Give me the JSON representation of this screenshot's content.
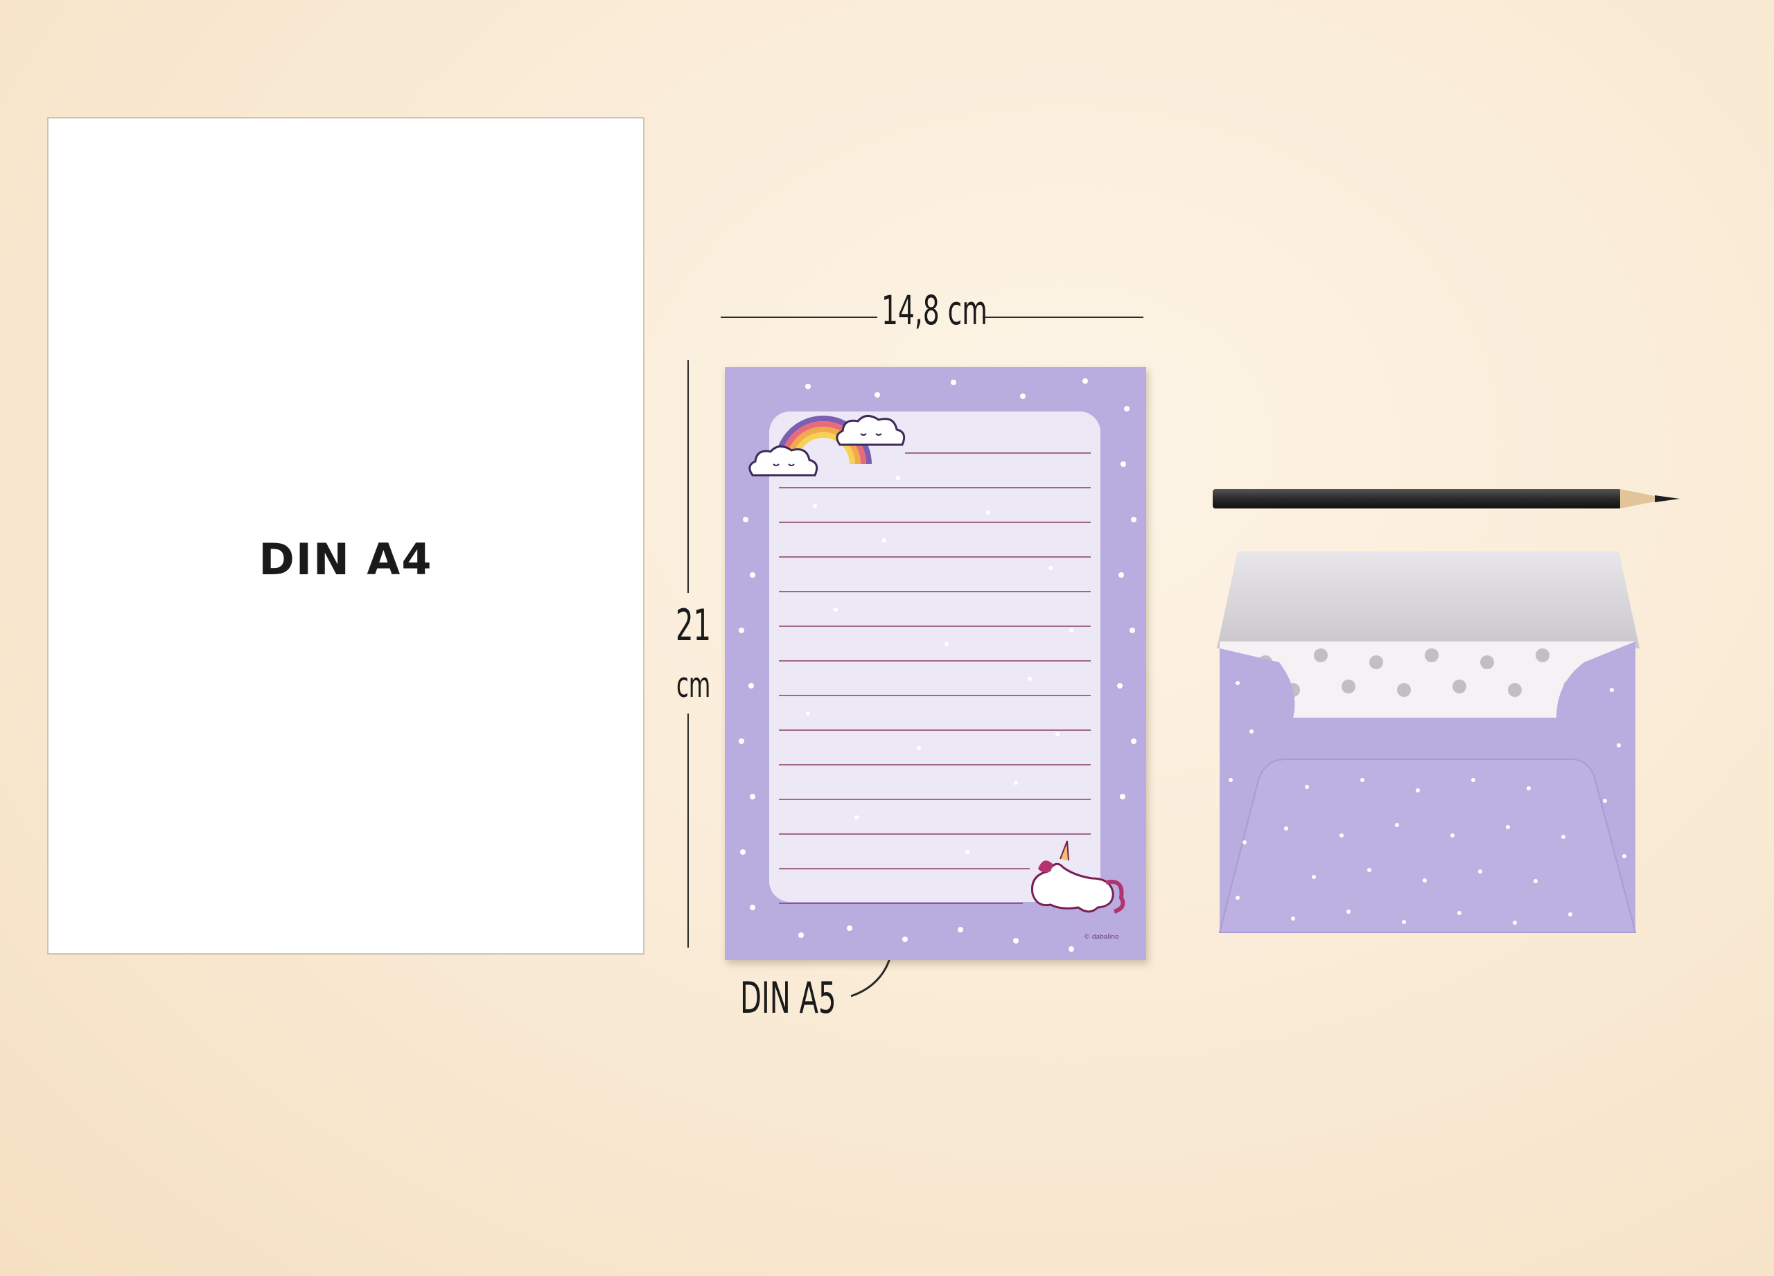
{
  "a4": {
    "label": "DIN A4"
  },
  "a5": {
    "label": "DIN A5",
    "width_label": "14,8 cm",
    "height_number": "21",
    "height_unit": "cm",
    "copyright": "© dabalino",
    "background_color": "#b9addf",
    "paper_color": "#ece8f6",
    "line_color": "#8a3a6a",
    "line_count": 14
  },
  "envelope": {
    "body_color": "#b9addf",
    "liner_color": "#ffffff"
  },
  "pencil": {
    "color": "#2e2e2e"
  },
  "icons": [
    "rainbow-icon",
    "cloud-icon",
    "unicorn-icon",
    "star-icon",
    "arrow-icon",
    "pencil-icon",
    "envelope-icon"
  ]
}
